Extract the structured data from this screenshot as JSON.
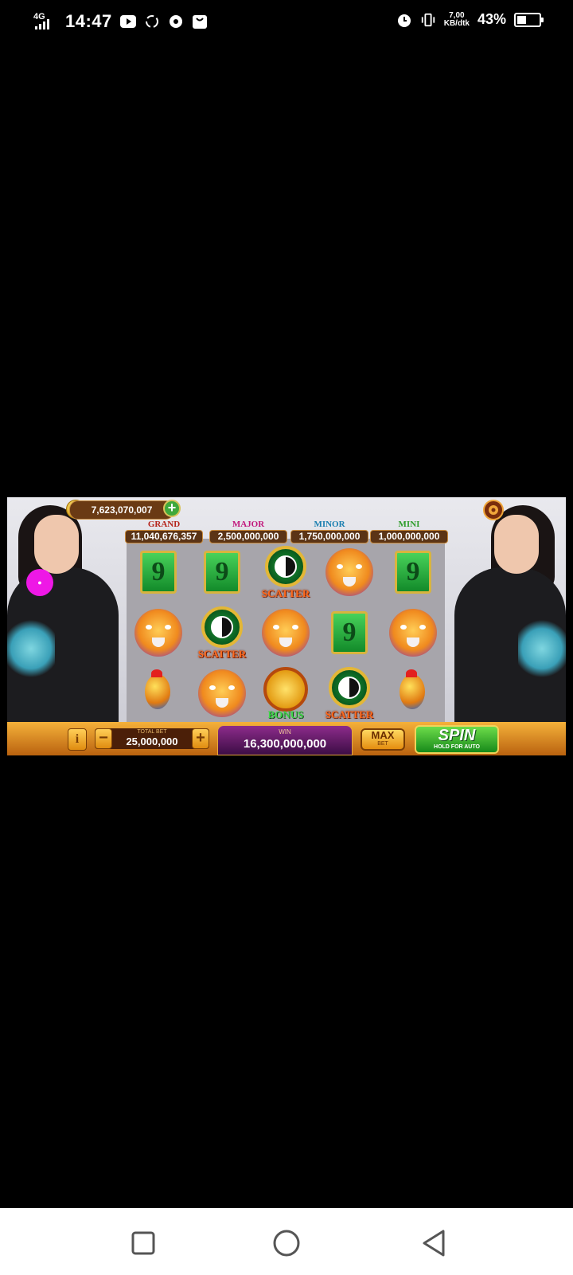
{
  "status_bar": {
    "network": "4G",
    "time": "14:47",
    "speed_value": "7,00",
    "speed_unit": "KB/dtk",
    "battery_percent": "43%",
    "battery_level": 0.43,
    "icons": [
      "youtube-icon",
      "sync-icon",
      "football-icon",
      "shopping-bag-icon",
      "alarm-icon",
      "vibrate-icon"
    ]
  },
  "game": {
    "coin_balance": "7,623,070,007",
    "jackpots": [
      {
        "label": "GRAND",
        "value": "11,040,676,357",
        "color": "#b5231a"
      },
      {
        "label": "MAJOR",
        "value": "2,500,000,000",
        "color": "#c2187c"
      },
      {
        "label": "MINOR",
        "value": "1,750,000,000",
        "color": "#1a7fb0"
      },
      {
        "label": "MINI",
        "value": "1,000,000,000",
        "color": "#2e9d2a"
      }
    ],
    "reels": [
      [
        "nine",
        "nine",
        "scatter",
        "tiger",
        "nine"
      ],
      [
        "tiger",
        "scatter",
        "tiger",
        "nine",
        "tiger"
      ],
      [
        "rooster",
        "tiger",
        "bonus",
        "scatter",
        "rooster"
      ]
    ],
    "symbol_labels": {
      "scatter": "SCATTER",
      "bonus": "BONUS",
      "nine": "9"
    },
    "info_label": "i",
    "total_bet_label": "TOTAL BET",
    "total_bet_value": "25,000,000",
    "win_label": "WIN",
    "win_value": "16,300,000,000",
    "max_label": "MAX",
    "max_sub": "BET",
    "spin_label": "SPIN",
    "spin_sub": "HOLD FOR AUTO"
  },
  "nav": {
    "icons": [
      "recents-square-icon",
      "home-circle-icon",
      "back-triangle-icon"
    ]
  }
}
